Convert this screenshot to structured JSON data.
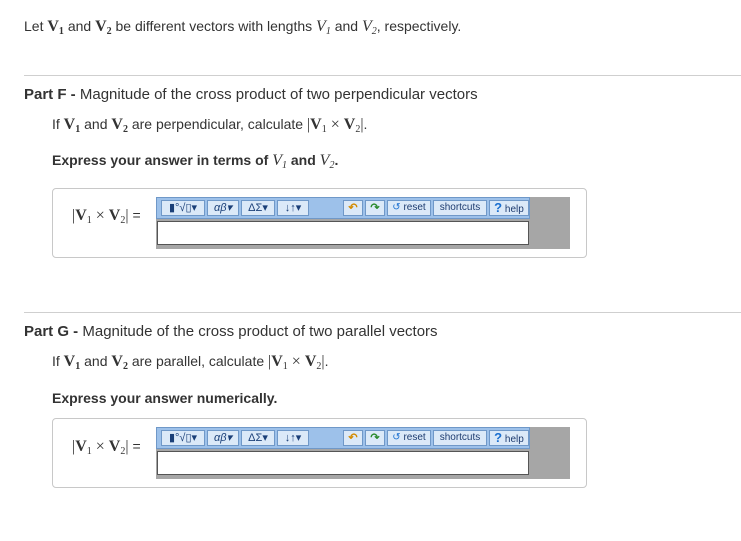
{
  "intro": {
    "let": "Let",
    "v1": "V",
    "and1": "and",
    "v2": "V",
    "rest": "be different vectors with lengths",
    "l1": "V",
    "and2": "and",
    "l2": "V",
    "end": ", respectively."
  },
  "partF": {
    "label": "Part F -",
    "title": "Magnitude of the cross product of two perpendicular vectors",
    "q_if": "If",
    "q_and": "and",
    "q_rest": "are perpendicular, calculate",
    "q_end": ".",
    "express": "Express your answer in terms of",
    "express_and": "and",
    "express_end": ".",
    "lhs_eq": "="
  },
  "partG": {
    "label": "Part G -",
    "title": "Magnitude of the cross product of two parallel vectors",
    "q_if": "If",
    "q_and": "and",
    "q_rest": "are parallel, calculate",
    "q_end": ".",
    "express": "Express your answer numerically.",
    "lhs_eq": "="
  },
  "toolbar": {
    "templates": "▮°√▯",
    "greek": "αβ",
    "symbols": "ΔΣ",
    "arrows": "↓↑",
    "caret": "▾",
    "undo": "↶",
    "redo": "↷",
    "reset": "reset",
    "shortcuts": "shortcuts",
    "help": "help",
    "help_q": "?"
  }
}
